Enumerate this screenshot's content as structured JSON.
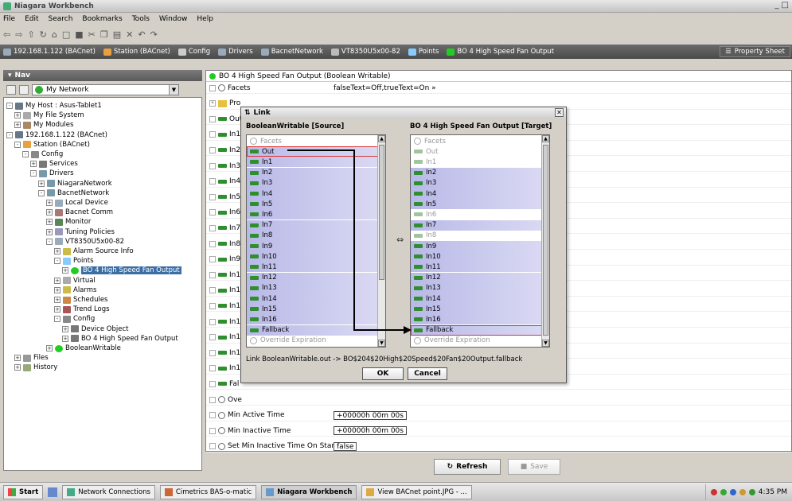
{
  "window": {
    "title": "Niagara Workbench"
  },
  "menu": [
    "File",
    "Edit",
    "Search",
    "Bookmarks",
    "Tools",
    "Window",
    "Help"
  ],
  "breadcrumb": [
    {
      "label": "192.168.1.122 (BACnet)",
      "icon": "host-icon",
      "color": "#9ab"
    },
    {
      "label": "Station (BACnet)",
      "icon": "station-icon",
      "color": "#e8a040"
    },
    {
      "label": "Config",
      "icon": "config-icon",
      "color": "#ccc"
    },
    {
      "label": "Drivers",
      "icon": "drivers-icon",
      "color": "#9ab"
    },
    {
      "label": "BacnetNetwork",
      "icon": "network-icon",
      "color": "#9ab"
    },
    {
      "label": "VT8350U5x00-82",
      "icon": "device-icon",
      "color": "#bbb"
    },
    {
      "label": "Points",
      "icon": "points-icon",
      "color": "#8cf"
    },
    {
      "label": "BO 4 High Speed Fan Output",
      "icon": "point-icon",
      "color": "#2c2"
    }
  ],
  "property_sheet_button": "Property Sheet",
  "nav": {
    "title": "Nav",
    "selector": "My Network",
    "tree": [
      {
        "label": "My Host : Asus-Tablet1",
        "depth": 0,
        "toggle": "-",
        "icon": "host-icon"
      },
      {
        "label": "My File System",
        "depth": 1,
        "toggle": "+",
        "icon": "filesystem-icon"
      },
      {
        "label": "My Modules",
        "depth": 1,
        "toggle": "+",
        "icon": "modules-icon"
      },
      {
        "label": "192.168.1.122 (BACnet)",
        "depth": 0,
        "toggle": "-",
        "icon": "host-icon"
      },
      {
        "label": "Station (BACnet)",
        "depth": 1,
        "toggle": "-",
        "icon": "station-icon"
      },
      {
        "label": "Config",
        "depth": 2,
        "toggle": "-",
        "icon": "config-icon"
      },
      {
        "label": "Services",
        "depth": 3,
        "toggle": "+",
        "icon": "services-icon"
      },
      {
        "label": "Drivers",
        "depth": 3,
        "toggle": "-",
        "icon": "drivers-icon"
      },
      {
        "label": "NiagaraNetwork",
        "depth": 4,
        "toggle": "+",
        "icon": "network-icon"
      },
      {
        "label": "BacnetNetwork",
        "depth": 4,
        "toggle": "-",
        "icon": "network-icon"
      },
      {
        "label": "Local Device",
        "depth": 5,
        "toggle": "+",
        "icon": "device-icon"
      },
      {
        "label": "Bacnet Comm",
        "depth": 5,
        "toggle": "+",
        "icon": "comm-icon"
      },
      {
        "label": "Monitor",
        "depth": 5,
        "toggle": "+",
        "icon": "monitor-icon"
      },
      {
        "label": "Tuning Policies",
        "depth": 5,
        "toggle": "+",
        "icon": "tuning-icon"
      },
      {
        "label": "VT8350U5x00-82",
        "depth": 5,
        "toggle": "-",
        "icon": "device-icon"
      },
      {
        "label": "Alarm Source Info",
        "depth": 6,
        "toggle": "+",
        "icon": "alarm-icon"
      },
      {
        "label": "Points",
        "depth": 6,
        "toggle": "-",
        "icon": "points-icon"
      },
      {
        "label": "BO 4 High Speed Fan Output",
        "depth": 7,
        "toggle": "+",
        "icon": "point-icon",
        "selected": true
      },
      {
        "label": "Virtual",
        "depth": 6,
        "toggle": "+",
        "icon": "virtual-icon"
      },
      {
        "label": "Alarms",
        "depth": 6,
        "toggle": "+",
        "icon": "alarm-icon"
      },
      {
        "label": "Schedules",
        "depth": 6,
        "toggle": "+",
        "icon": "schedule-icon"
      },
      {
        "label": "Trend Logs",
        "depth": 6,
        "toggle": "+",
        "icon": "trend-icon"
      },
      {
        "label": "Config",
        "depth": 6,
        "toggle": "-",
        "icon": "config-icon"
      },
      {
        "label": "Device Object",
        "depth": 7,
        "toggle": "+",
        "icon": "object-icon"
      },
      {
        "label": "BO 4 High Speed Fan Output",
        "depth": 7,
        "toggle": "+",
        "icon": "object-icon"
      },
      {
        "label": "BooleanWritable",
        "depth": 5,
        "toggle": "+",
        "icon": "point-icon"
      },
      {
        "label": "Files",
        "depth": 1,
        "toggle": "+",
        "icon": "files-icon"
      },
      {
        "label": "History",
        "depth": 1,
        "toggle": "+",
        "icon": "history-icon"
      }
    ]
  },
  "sheet": {
    "header": "BO 4 High Speed Fan Output  (Boolean Writable)",
    "rows": [
      {
        "label": "Facets",
        "kind": "prop",
        "value": "falseText=Off,trueText=On  »"
      },
      {
        "label": "Pro",
        "kind": "folder",
        "value": ""
      },
      {
        "label": "Out",
        "kind": "slot",
        "value": ""
      },
      {
        "label": "In1",
        "kind": "slot",
        "value": ""
      },
      {
        "label": "In2",
        "kind": "slot",
        "value": ""
      },
      {
        "label": "In3",
        "kind": "slot",
        "value": ""
      },
      {
        "label": "In4",
        "kind": "slot",
        "value": ""
      },
      {
        "label": "In5",
        "kind": "slot",
        "value": ""
      },
      {
        "label": "In6",
        "kind": "slot",
        "value": ""
      },
      {
        "label": "In7",
        "kind": "slot",
        "value": ""
      },
      {
        "label": "In8",
        "kind": "slot",
        "value": ""
      },
      {
        "label": "In9",
        "kind": "slot",
        "value": ""
      },
      {
        "label": "In1",
        "kind": "slot",
        "value": ""
      },
      {
        "label": "In1",
        "kind": "slot",
        "value": ""
      },
      {
        "label": "In1",
        "kind": "slot",
        "value": ""
      },
      {
        "label": "In1",
        "kind": "slot",
        "value": ""
      },
      {
        "label": "In1",
        "kind": "slot",
        "value": ""
      },
      {
        "label": "In1",
        "kind": "slot",
        "value": ""
      },
      {
        "label": "In1",
        "kind": "slot",
        "value": ""
      },
      {
        "label": "Fal",
        "kind": "slot",
        "value": ""
      },
      {
        "label": "Ove",
        "kind": "prop",
        "value": ""
      },
      {
        "label": "Min Active Time",
        "kind": "prop",
        "value": "+00000h 00m 00s"
      },
      {
        "label": "Min Inactive Time",
        "kind": "prop",
        "value": "+00000h 00m 00s"
      },
      {
        "label": "Set Min Inactive Time On Start",
        "kind": "prop",
        "value": "false"
      }
    ],
    "refresh_label": "Refresh",
    "save_label": "Save"
  },
  "link_dialog": {
    "title": "Link",
    "source_title": "BooleanWritable [Source]",
    "target_title": "BO 4 High Speed Fan Output [Target]",
    "source_items": [
      {
        "label": "Facets",
        "kind": "prop",
        "dim": true
      },
      {
        "label": "Out",
        "kind": "slot",
        "boxed": true
      },
      {
        "label": "In1",
        "kind": "slot"
      },
      {
        "label": "In2",
        "kind": "slot"
      },
      {
        "label": "In3",
        "kind": "slot"
      },
      {
        "label": "In4",
        "kind": "slot"
      },
      {
        "label": "In5",
        "kind": "slot"
      },
      {
        "label": "In6",
        "kind": "slot"
      },
      {
        "label": "In7",
        "kind": "slot"
      },
      {
        "label": "In8",
        "kind": "slot"
      },
      {
        "label": "In9",
        "kind": "slot"
      },
      {
        "label": "In10",
        "kind": "slot"
      },
      {
        "label": "In11",
        "kind": "slot"
      },
      {
        "label": "In12",
        "kind": "slot"
      },
      {
        "label": "In13",
        "kind": "slot"
      },
      {
        "label": "In14",
        "kind": "slot"
      },
      {
        "label": "In15",
        "kind": "slot"
      },
      {
        "label": "In16",
        "kind": "slot"
      },
      {
        "label": "Fallback",
        "kind": "slot"
      },
      {
        "label": "Override Expiration",
        "kind": "prop",
        "dim": true
      }
    ],
    "target_items": [
      {
        "label": "Facets",
        "kind": "prop",
        "dim": true
      },
      {
        "label": "Out",
        "kind": "slot",
        "dim": true
      },
      {
        "label": "In1",
        "kind": "slot",
        "dim": true
      },
      {
        "label": "In2",
        "kind": "slot"
      },
      {
        "label": "In3",
        "kind": "slot"
      },
      {
        "label": "In4",
        "kind": "slot"
      },
      {
        "label": "In5",
        "kind": "slot"
      },
      {
        "label": "In6",
        "kind": "slot",
        "dim": true
      },
      {
        "label": "In7",
        "kind": "slot"
      },
      {
        "label": "In8",
        "kind": "slot",
        "dim": true
      },
      {
        "label": "In9",
        "kind": "slot"
      },
      {
        "label": "In10",
        "kind": "slot"
      },
      {
        "label": "In11",
        "kind": "slot"
      },
      {
        "label": "In12",
        "kind": "slot"
      },
      {
        "label": "In13",
        "kind": "slot"
      },
      {
        "label": "In14",
        "kind": "slot"
      },
      {
        "label": "In15",
        "kind": "slot"
      },
      {
        "label": "In16",
        "kind": "slot"
      },
      {
        "label": "Fallback",
        "kind": "slot",
        "boxed": true
      },
      {
        "label": "Override Expiration",
        "kind": "prop",
        "dim": true
      }
    ],
    "link_text": "Link BooleanWritable.out -> BO$204$20High$20Speed$20Fan$20Output.fallback",
    "ok_label": "OK",
    "cancel_label": "Cancel",
    "swap_glyph": "⇔"
  },
  "taskbar": {
    "start_label": "Start",
    "items": [
      {
        "label": "Network Connections",
        "active": false
      },
      {
        "label": "Cimetrics BAS-o-matic",
        "active": false
      },
      {
        "label": "Niagara Workbench",
        "active": true
      },
      {
        "label": "View BACnet point.JPG - ...",
        "active": false
      }
    ],
    "clock": "4:35 PM"
  },
  "colors": {
    "slot_green": "#2f8f2f",
    "highlight": "#3a6ea5",
    "link_box": "#dd3333"
  }
}
